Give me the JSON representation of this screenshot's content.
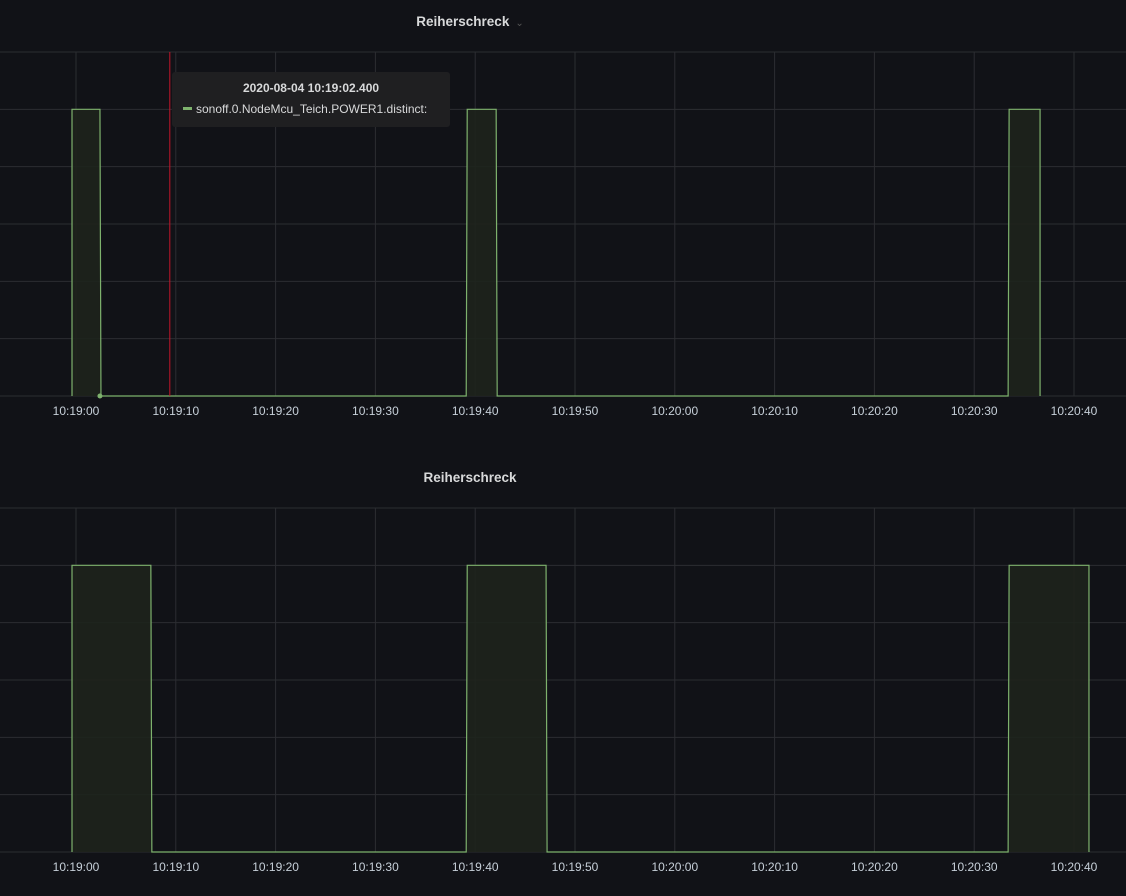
{
  "colors": {
    "background": "#111217",
    "grid": "#2c2d32",
    "series": "#7eb26d",
    "series_fill": "#1e231c",
    "cursor": "#c4162a"
  },
  "panels": [
    {
      "title": "Reiherschreck",
      "title_dropdown_icon": "chevron-down-icon",
      "tooltip": {
        "time": "2020-08-04 10:19:02.400",
        "series": "sonoff.0.NodeMcu_Teich.POWER1.distinct:"
      }
    },
    {
      "title": "Reiherschreck"
    }
  ],
  "chart_data": [
    {
      "type": "area",
      "title": "Reiherschreck",
      "x_ticks": [
        "10:19:00",
        "10:19:10",
        "10:19:20",
        "10:19:30",
        "10:19:40",
        "10:19:50",
        "10:20:00",
        "10:20:10",
        "10:20:20",
        "10:20:30",
        "10:20:40"
      ],
      "x_range": [
        "10:18:54",
        "10:20:45"
      ],
      "y_range": [
        0,
        1.2
      ],
      "grid": true,
      "step": true,
      "cursor_time": "10:19:09.4",
      "series": [
        {
          "label": "sonoff.0.NodeMcu_Teich.POWER1.distinct:",
          "x": [
            "10:18:59.6",
            "10:19:02.4",
            "10:19:02.5",
            "10:19:39.1",
            "10:19:39.2",
            "10:19:42.1",
            "10:19:42.2",
            "10:20:33.4",
            "10:20:33.5",
            "10:20:36.6"
          ],
          "y": [
            1,
            1,
            0,
            0,
            1,
            1,
            0,
            0,
            1,
            1
          ]
        }
      ]
    },
    {
      "type": "area",
      "title": "Reiherschreck",
      "x_ticks": [
        "10:19:00",
        "10:19:10",
        "10:19:20",
        "10:19:30",
        "10:19:40",
        "10:19:50",
        "10:20:00",
        "10:20:10",
        "10:20:20",
        "10:20:30",
        "10:20:40"
      ],
      "x_range": [
        "10:18:54",
        "10:20:45"
      ],
      "y_range": [
        0,
        1.2
      ],
      "grid": true,
      "step": true,
      "series": [
        {
          "label": "sonoff.0.NodeMcu_Teich.POWER1.distinct:",
          "x": [
            "10:18:59.6",
            "10:19:07.5",
            "10:19:07.6",
            "10:19:39.1",
            "10:19:39.2",
            "10:19:47.1",
            "10:19:47.2",
            "10:20:33.4",
            "10:20:33.5",
            "10:20:41.5"
          ],
          "y": [
            1,
            1,
            0,
            0,
            1,
            1,
            0,
            0,
            1,
            1
          ]
        }
      ]
    }
  ]
}
